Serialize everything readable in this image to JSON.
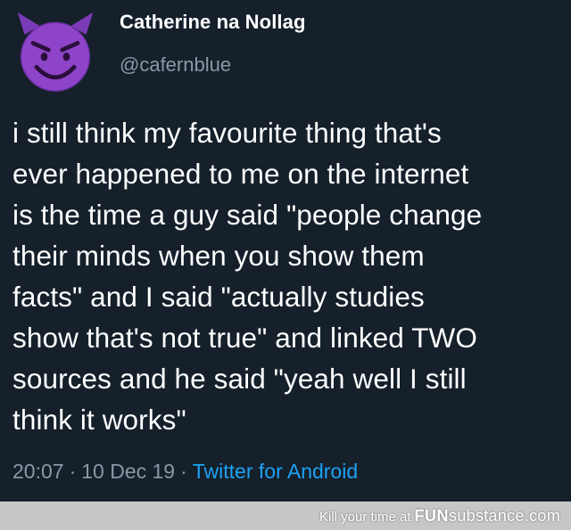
{
  "tweet": {
    "author_name": "Catherine na Nollag",
    "author_handle": "@cafernblue",
    "avatar_icon": "smiling-face-with-horns-icon",
    "text": "i still think my favourite thing that's\never happened to me on the internet\nis the time a guy said \"people change\ntheir minds when you show them\nfacts\" and I said \"actually studies\nshow that's not true\" and linked TWO\nsources and he said \"yeah well I still\nthink it works\"",
    "time": "20:07",
    "date": "10 Dec 19",
    "separator": "·",
    "source": "Twitter for Android"
  },
  "watermark": {
    "prefix": "Kill your time at",
    "brand_fun": "FUN",
    "brand_sub": "substance.com"
  },
  "colors": {
    "background": "#15202b",
    "text": "#ffffff",
    "muted": "#8899a6",
    "link": "#1da1f2",
    "avatar_purple": "#8e44c9"
  }
}
